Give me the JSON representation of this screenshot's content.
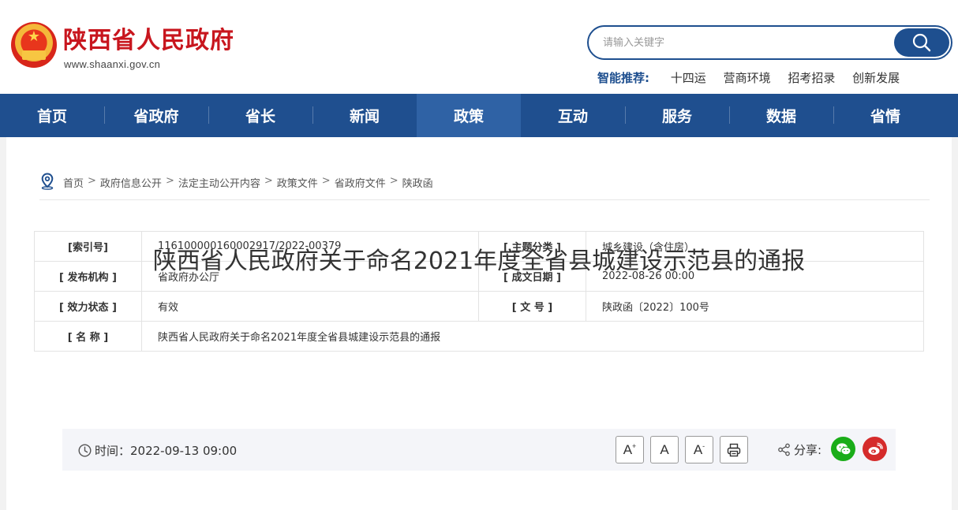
{
  "site": {
    "title": "陕西省人民政府",
    "url": "www.shaanxi.gov.cn"
  },
  "search": {
    "placeholder": "请输入关键字"
  },
  "smart": {
    "label": "智能推荐:",
    "tags": [
      "十四运",
      "营商环境",
      "招考招录",
      "创新发展"
    ]
  },
  "nav": {
    "items": [
      "首页",
      "省政府",
      "省长",
      "新闻",
      "政策",
      "互动",
      "服务",
      "数据",
      "省情"
    ],
    "active": "政策"
  },
  "breadcrumb": [
    "首页",
    "政府信息公开",
    "法定主动公开内容",
    "政策文件",
    "省政府文件",
    "陕政函"
  ],
  "breadcrumb_sep": ">",
  "meta": {
    "index_label": "[索引号]",
    "index_value": "11610000016000​2917/2022-00379",
    "topic_label": "[ 主题分类 ]",
    "topic_value": "城乡建设（含住房）",
    "issuer_label": "[ 发布机构 ]",
    "issuer_value": "省政府办公厅",
    "date_label": "[ 成文日期 ]",
    "date_value": "2022-08-26 00:00",
    "status_label": "[ 效力状态 ]",
    "status_value": "有效",
    "docno_label": "[ 文 号 ]",
    "docno_value": "陕政函〔2022〕100号",
    "name_label": "[ 名 称 ]",
    "name_value": "陕西省人民政府关于命名2021年度全省县城建设示范县的通报"
  },
  "article": {
    "title": "陕西省人民政府关于命名2021年度全省县城建设示范县的通报",
    "time": "时间：2022-09-13 09:00",
    "font_up": "A",
    "font_normal": "A",
    "font_down": "A",
    "share_label": "分享:"
  },
  "colors": {
    "brand_red": "#c8161e",
    "nav_blue": "#1f4f8f",
    "nav_active": "#2f62a5",
    "wechat_green": "#1aad19",
    "weibo_red": "#d52b2b"
  }
}
